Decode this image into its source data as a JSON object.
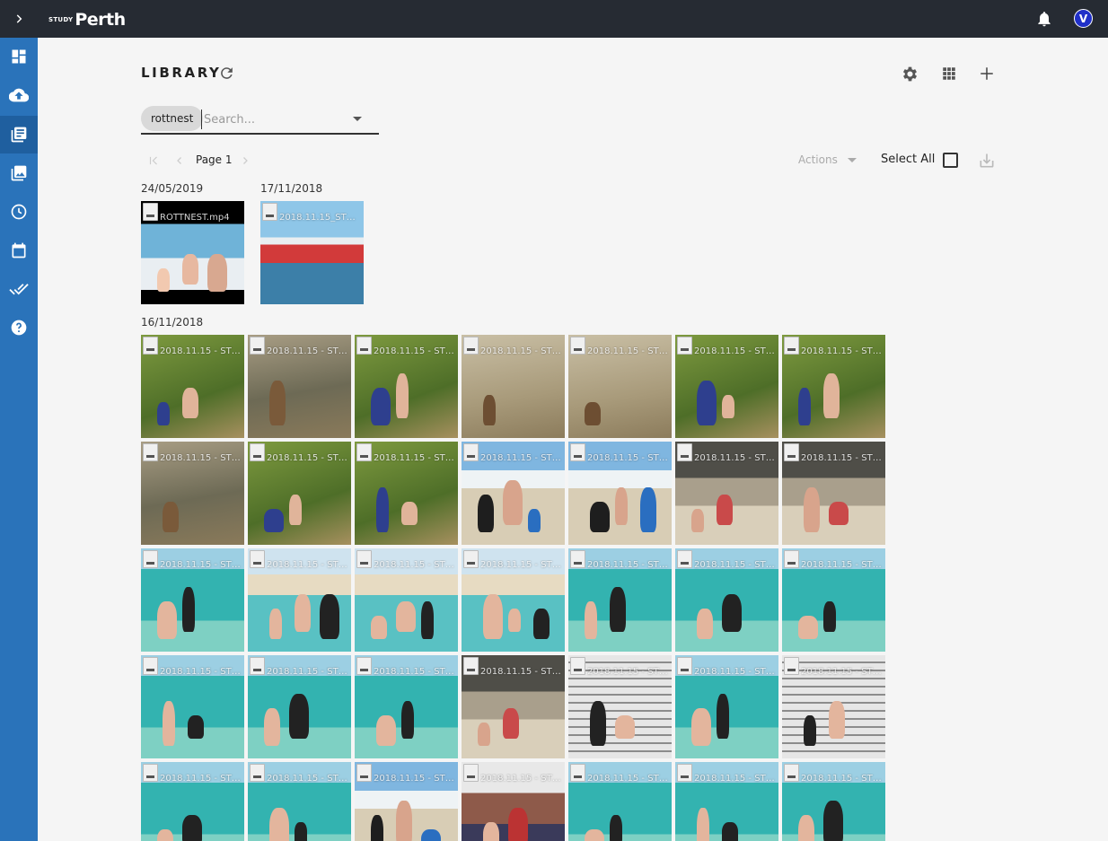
{
  "brand": {
    "small": "STUDY",
    "big": "Perth"
  },
  "user": {
    "avatar_letter": "V"
  },
  "header": {
    "title": "LIBRARY"
  },
  "search": {
    "chip": "rottnest",
    "placeholder": "Search..."
  },
  "pager": {
    "page_label": "Page 1"
  },
  "actions": {
    "label": "Actions",
    "select_all": "Select All"
  },
  "groups": [
    {
      "date": "24/05/2019",
      "items": [
        {
          "name": "ROTTNEST.mp4",
          "palette": "video"
        }
      ]
    },
    {
      "date": "17/11/2018",
      "items": [
        {
          "name": "2018.11.15_STUD...",
          "palette": "ferry"
        }
      ]
    },
    {
      "date": "16/11/2018",
      "items": [
        {
          "name": "2018.11.15 - STUD...",
          "palette": "grass"
        },
        {
          "name": "2018.11.15 - STUD...",
          "palette": "quokka"
        },
        {
          "name": "2018.11.15 - STUD...",
          "palette": "grass"
        },
        {
          "name": "2018.11.15 - STUD...",
          "palette": "sand"
        },
        {
          "name": "2018.11.15 - STUD...",
          "palette": "sand"
        },
        {
          "name": "2018.11.15 - STUD...",
          "palette": "grass"
        },
        {
          "name": "2018.11.15 - STUD...",
          "palette": "grass"
        },
        {
          "name": "2018.11.15 - STUD...",
          "palette": "quokka"
        },
        {
          "name": "2018.11.15 - STUD...",
          "palette": "grass"
        },
        {
          "name": "2018.11.15 - STUD...",
          "palette": "grass"
        },
        {
          "name": "2018.11.15 - STUD...",
          "palette": "beach"
        },
        {
          "name": "2018.11.15 - STUD...",
          "palette": "beach"
        },
        {
          "name": "2018.11.15 - STUD...",
          "palette": "rock"
        },
        {
          "name": "2018.11.15 - STUD...",
          "palette": "rock"
        },
        {
          "name": "2018.11.15 - STUD...",
          "palette": "water"
        },
        {
          "name": "2018.11.15 - STUD...",
          "palette": "shore"
        },
        {
          "name": "2018.11.15 - STUD...",
          "palette": "shore"
        },
        {
          "name": "2018.11.15 - STUD...",
          "palette": "shore"
        },
        {
          "name": "2018.11.15 - STUD...",
          "palette": "water"
        },
        {
          "name": "2018.11.15 - STUD...",
          "palette": "water"
        },
        {
          "name": "2018.11.15 - STUD...",
          "palette": "water"
        },
        {
          "name": "2018.11.15 - STUD...",
          "palette": "water"
        },
        {
          "name": "2018.11.15 - STUD...",
          "palette": "water"
        },
        {
          "name": "2018.11.15 - STUD...",
          "palette": "water"
        },
        {
          "name": "2018.11.15 - STUD...",
          "palette": "rock"
        },
        {
          "name": "2018.11.15 - STUD...",
          "palette": "stairs"
        },
        {
          "name": "2018.11.15 - STUD...",
          "palette": "water"
        },
        {
          "name": "2018.11.15 - STUD...",
          "palette": "stairs"
        },
        {
          "name": "2018.11.15 - STUD...",
          "palette": "water"
        },
        {
          "name": "2018.11.15 - STUD...",
          "palette": "water"
        },
        {
          "name": "2018.11.15 - STUD...",
          "palette": "beach"
        },
        {
          "name": "2018.11.15 - STUD...",
          "palette": "crowd"
        },
        {
          "name": "2018.11.15 - STUD...",
          "palette": "water"
        },
        {
          "name": "2018.11.15 - STUD...",
          "palette": "water"
        },
        {
          "name": "2018.11.15 - STUD...",
          "palette": "water"
        }
      ]
    }
  ],
  "colors": {
    "topbar": "#262b33",
    "sidebar": "#2a73ba",
    "sidebar_active": "#1f5f9f",
    "background": "#f5f5f5",
    "avatar": "#2030c8"
  }
}
